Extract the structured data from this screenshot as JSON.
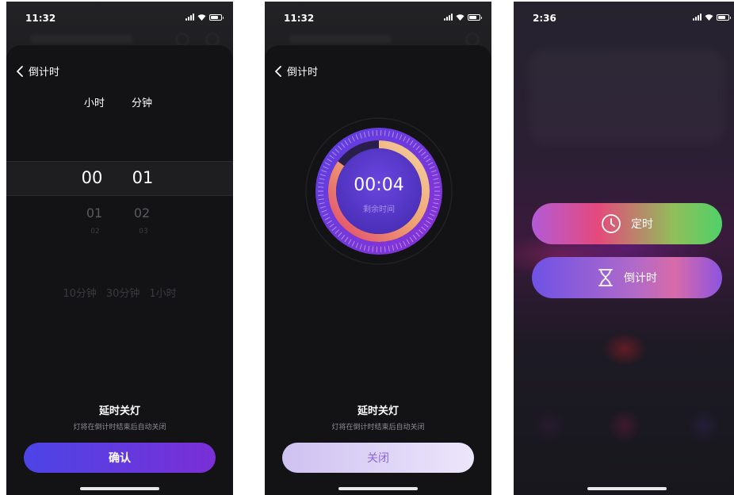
{
  "screen1": {
    "status_time": "11:32",
    "back_label": "倒计时",
    "hour_header": "小时",
    "minute_header": "分钟",
    "hour_selected": "00",
    "minute_selected": "01",
    "hour_next": "01",
    "minute_next": "02",
    "hour_next2": "02",
    "minute_next2": "03",
    "presets": [
      "10分钟",
      "30分钟",
      "1小时"
    ],
    "footer_title": "延时关灯",
    "footer_subtitle": "灯将在倒计时结束后自动关闭",
    "confirm_label": "确认"
  },
  "screen2": {
    "status_time": "11:32",
    "back_label": "倒计时",
    "remaining_time": "00:04",
    "remaining_label": "剩余时间",
    "progress": 0.85,
    "footer_title": "延时关灯",
    "footer_subtitle": "灯将在倒计时结束后自动关闭",
    "close_label": "关闭"
  },
  "screen3": {
    "status_time": "2:36",
    "timer_label": "定时",
    "countdown_label": "倒计时"
  },
  "colors": {
    "confirm_start": "#4c44e6",
    "confirm_end": "#7a2fd6",
    "close_start": "#cfc1f1",
    "close_text": "#8d66d6",
    "sheet_bg": "#131315"
  },
  "icons": {
    "back": "chevron-left-icon",
    "timer": "clock-icon",
    "countdown": "hourglass-icon"
  }
}
